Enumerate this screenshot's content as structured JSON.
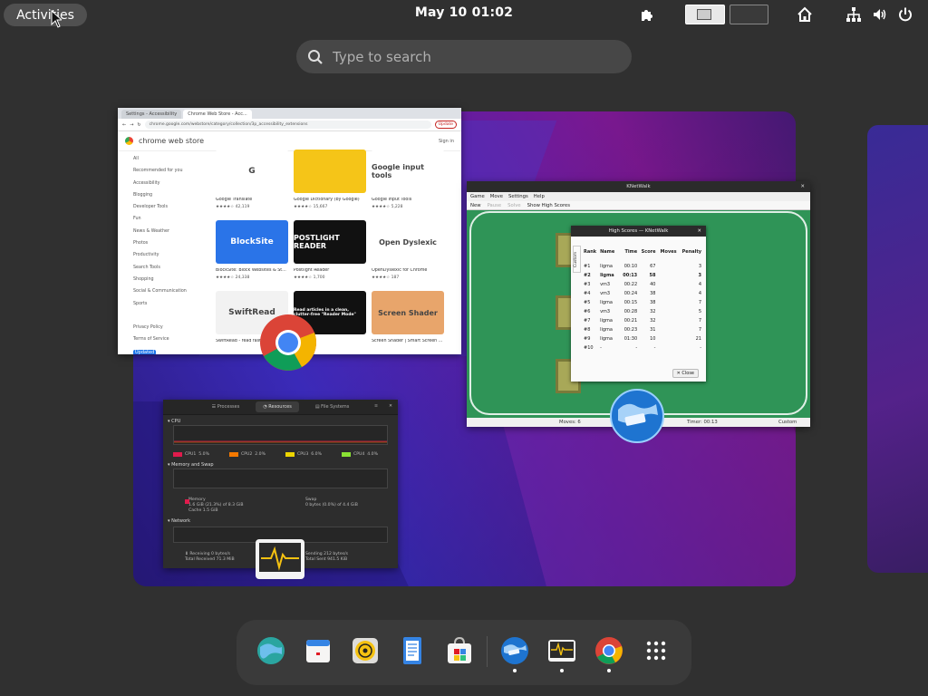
{
  "topbar": {
    "activities_label": "Activities",
    "clock": "May 10  01:02"
  },
  "search": {
    "placeholder": "Type to search"
  },
  "chrome_window": {
    "tabs": [
      "Settings - Accessibility",
      "Chrome Web Store - Acc..."
    ],
    "url": "chrome.google.com/webstore/category/collection/3p_accessibility_extensions",
    "update_label": "Update",
    "store_title": "chrome web store",
    "signin": "Sign in",
    "sidebar": [
      "All",
      "Recommended for you",
      "Accessibility",
      "Blogging",
      "Developer Tools",
      "Fun",
      "News & Weather",
      "Photos",
      "Productivity",
      "Search Tools",
      "Shopping",
      "Social & Communication",
      "Sports",
      "",
      "Privacy Policy",
      "Terms of Service",
      "About Chrome Web Store"
    ],
    "sidebar_updated_badge": "Updated",
    "cards": [
      {
        "name": "Google Translate",
        "rating": "★★★★☆ 42,119",
        "logo": "G",
        "color": "#ffffff"
      },
      {
        "name": "Google Dictionary (by Google)",
        "rating": "★★★★☆ 15,667",
        "logo": "",
        "color": "#f5c518"
      },
      {
        "name": "Google Input Tools",
        "rating": "★★★★☆ 5,228",
        "logo": "Google input tools",
        "color": "#ffffff"
      },
      {
        "name": "BlockSite: Block Websites & St...",
        "rating": "★★★★☆ 24,338",
        "logo": "BlockSite",
        "color": "#2a74e8"
      },
      {
        "name": "Postlight Reader",
        "rating": "★★★★☆ 1,700",
        "logo": "POSTLIGHT READER",
        "color": "#111111"
      },
      {
        "name": "OpenDyslexic for Chrome",
        "rating": "★★★★☆ 187",
        "logo": "Open Dyslexic",
        "color": "#ffffff"
      },
      {
        "name": "SwiftRead - read faster, learn m...",
        "rating": "",
        "logo": "SwiftRead",
        "color": "#f2f2f2"
      },
      {
        "name": "",
        "rating": "",
        "logo": "Read articles in a clean, clutter-free \"Reader Mode\"",
        "color": "#111111"
      },
      {
        "name": "Screen Shader | Smart Screen ...",
        "rating": "",
        "logo": "Screen Shader",
        "color": "#e8a56b"
      }
    ]
  },
  "knetwalk_window": {
    "title": "KNetWalk",
    "menu": [
      "Game",
      "Move",
      "Settings",
      "Help"
    ],
    "toolbar": [
      "New",
      "Pause",
      "Solve",
      "Show High Scores"
    ],
    "status_moves": "Moves: 6",
    "status_timer": "Timer: 00:13",
    "status_level": "Custom",
    "dialog": {
      "title": "High Scores — KNetWalk",
      "side_tab": "Custom",
      "headers": [
        "Rank",
        "Name",
        "Time",
        "Score",
        "Moves",
        "Penalty"
      ],
      "rows": [
        [
          "#1",
          "ligma",
          "00:10",
          "67",
          "",
          "3"
        ],
        [
          "#2",
          "ligma",
          "00:13",
          "58",
          "",
          "3"
        ],
        [
          "#3",
          "vm3",
          "00:22",
          "40",
          "",
          "4"
        ],
        [
          "#4",
          "vm3",
          "00:24",
          "38",
          "",
          "4"
        ],
        [
          "#5",
          "ligma",
          "00:15",
          "38",
          "",
          "7"
        ],
        [
          "#6",
          "vm3",
          "00:28",
          "32",
          "",
          "5"
        ],
        [
          "#7",
          "ligma",
          "00:21",
          "32",
          "",
          "7"
        ],
        [
          "#8",
          "ligma",
          "00:23",
          "31",
          "",
          "7"
        ],
        [
          "#9",
          "ligma",
          "01:30",
          "10",
          "",
          "21"
        ],
        [
          "#10",
          "-",
          "-",
          "-",
          "",
          "-"
        ]
      ],
      "close_label": "Close"
    }
  },
  "sysmon_window": {
    "tabs": [
      "Processes",
      "Resources",
      "File Systems"
    ],
    "cpu_label": "CPU",
    "cpu_legend": [
      {
        "name": "CPU1",
        "value": "5.0%",
        "color": "#e01b4c"
      },
      {
        "name": "CPU2",
        "value": "2.0%",
        "color": "#f57900"
      },
      {
        "name": "CPU3",
        "value": "6.0%",
        "color": "#edd400"
      },
      {
        "name": "CPU4",
        "value": "4.0%",
        "color": "#8ae234"
      }
    ],
    "memory_label": "Memory and Swap",
    "memory_text": "Memory",
    "memory_detail": "1.6 GiB (21.3%) of 8.3 GiB",
    "cache_text": "Cache 1.5 GiB",
    "swap_text": "Swap",
    "swap_detail": "0 bytes (0.0%) of 4.4 GiB",
    "network_label": "Network",
    "receiving": "Receiving",
    "receiving_value": "0 bytes/s",
    "total_received": "Total Received",
    "total_received_value": "71.3 MiB",
    "sending": "Sending",
    "sending_value": "212 bytes/s",
    "total_sent": "Total Sent",
    "total_sent_value": "941.5 KiB"
  },
  "dash": {
    "apps": [
      "browser-globe",
      "calendar",
      "music-player",
      "text-editor",
      "software-store",
      "web-app",
      "system-monitor",
      "chrome",
      "app-grid"
    ]
  }
}
